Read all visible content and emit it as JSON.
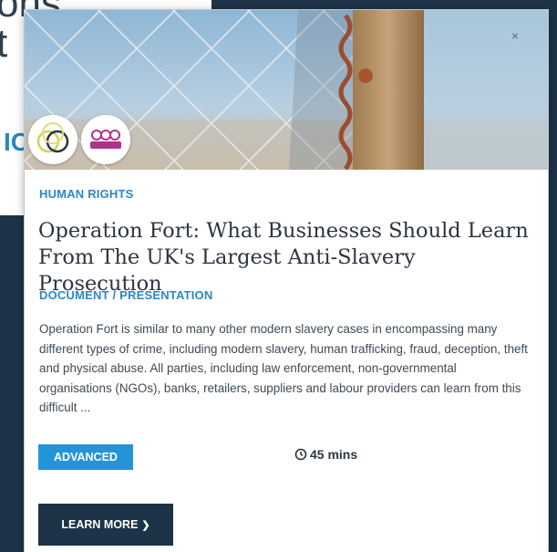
{
  "background": {
    "heading_line_1": "ons",
    "heading_line_2": "t",
    "link_fragment": "IC"
  },
  "modal": {
    "close_label": "×",
    "category": "HUMAN RIGHTS",
    "title": "Operation Fort: What Businesses Should Learn From The UK's Largest Anti-Slavery Prosecution",
    "doc_type": "DOCUMENT / PRESENTATION",
    "description": "Operation Fort is similar to many other modern slavery cases in encompassing many different types of crime, including modern slavery, human trafficking, fraud, deception, theft and physical abuse. All parties, including law enforcement, non-governmental organisations (NGOs), banks, retailers, suppliers and labour providers can learn from this difficult ...",
    "level": "ADVANCED",
    "duration": "45 mins",
    "learn_more_label": "LEARN MORE",
    "badges": [
      {
        "icon": "interlocking-rings-icon",
        "color": "#d8cf55"
      },
      {
        "icon": "people-group-icon",
        "color": "#b0338a"
      }
    ]
  },
  "colors": {
    "accent_blue": "#2b87c7",
    "level_badge": "#2494d9",
    "navy": "#1d3347",
    "text_dark": "#2c3440"
  }
}
